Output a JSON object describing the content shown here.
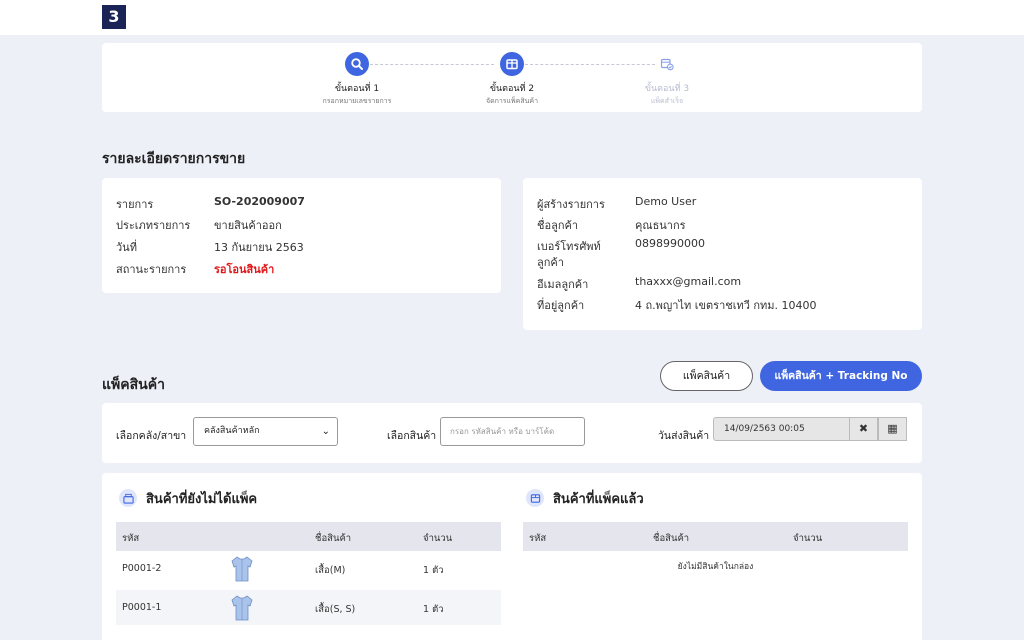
{
  "logo": {
    "glyph": "3"
  },
  "steps": [
    {
      "title": "ขั้นตอนที่ 1",
      "sub": "กรอกหมายเลขรายการ",
      "icon": "search-icon",
      "active": true
    },
    {
      "title": "ขั้นตอนที่ 2",
      "sub": "จัดการแพ็คสินค้า",
      "icon": "box-icon",
      "active": true
    },
    {
      "title": "ขั้นตอนที่ 3",
      "sub": "แพ็คสำเร็จ",
      "icon": "package-check-icon",
      "active": false
    }
  ],
  "details": {
    "title": "รายละเอียดรายการขาย",
    "left": [
      {
        "label": "รายการ",
        "value": "SO-202009007",
        "style": "bold"
      },
      {
        "label": "ประเภทรายการ",
        "value": "ขายสินค้าออก",
        "style": ""
      },
      {
        "label": "วันที่",
        "value": "13 กันยายน 2563",
        "style": ""
      },
      {
        "label": "สถานะรายการ",
        "value": "รอโอนสินค้า",
        "style": "red"
      }
    ],
    "right": {
      "creator_label": "ผู้สร้างรายการ",
      "creator": "Demo User",
      "customer_label": "ชื่อลูกค้า",
      "customer": "คุณธนากร",
      "phone_label_1": "เบอร์โทรศัพท์",
      "phone_label_2": "ลูกค้า",
      "phone": "0898990000",
      "email_label": "อีเมลลูกค้า",
      "email": "thaxxx@gmail.com",
      "address_label": "ที่อยู่ลูกค้า",
      "address": "4 ถ.พญาไท เขตราชเทวี กทม. 10400"
    }
  },
  "pack": {
    "title": "แพ็คสินค้า",
    "pack_button": "แพ็คสินค้า",
    "pack_tracking_button": "แพ็คสินค้า + Tracking No"
  },
  "filter": {
    "warehouse_label": "เลือกคลัง/สาขา",
    "warehouse_value": "คลังสินค้าหลัก",
    "product_label": "เลือกสินค้า",
    "product_placeholder": "กรอก รหัสสินค้า หรือ บาร์โค้ด",
    "ship_date_label": "วันส่งสินค้า",
    "ship_date_value": "14/09/2563 00:05",
    "clear_glyph": "✖",
    "calendar_glyph": "▦"
  },
  "unpacked": {
    "title": "สินค้าที่ยังไม่ได้แพ็ค",
    "columns": [
      "รหัส",
      "ชื่อสินค้า",
      "จำนวน"
    ],
    "rows": [
      {
        "code": "P0001-2",
        "name": "เสื้อ(M)",
        "qty": "1 ตัว"
      },
      {
        "code": "P0001-1",
        "name": "เสื้อ(S, S)",
        "qty": "1 ตัว"
      }
    ]
  },
  "packed": {
    "title": "สินค้าที่แพ็คแล้ว",
    "columns": [
      "รหัส",
      "ชื่อสินค้า",
      "จำนวน"
    ],
    "empty_text": "ยังไม่มีสินค้าในกล่อง"
  },
  "colors": {
    "accent": "#3f66e0",
    "danger": "#e0181b",
    "background": "#eef0f8",
    "brand": "#1b2456"
  }
}
